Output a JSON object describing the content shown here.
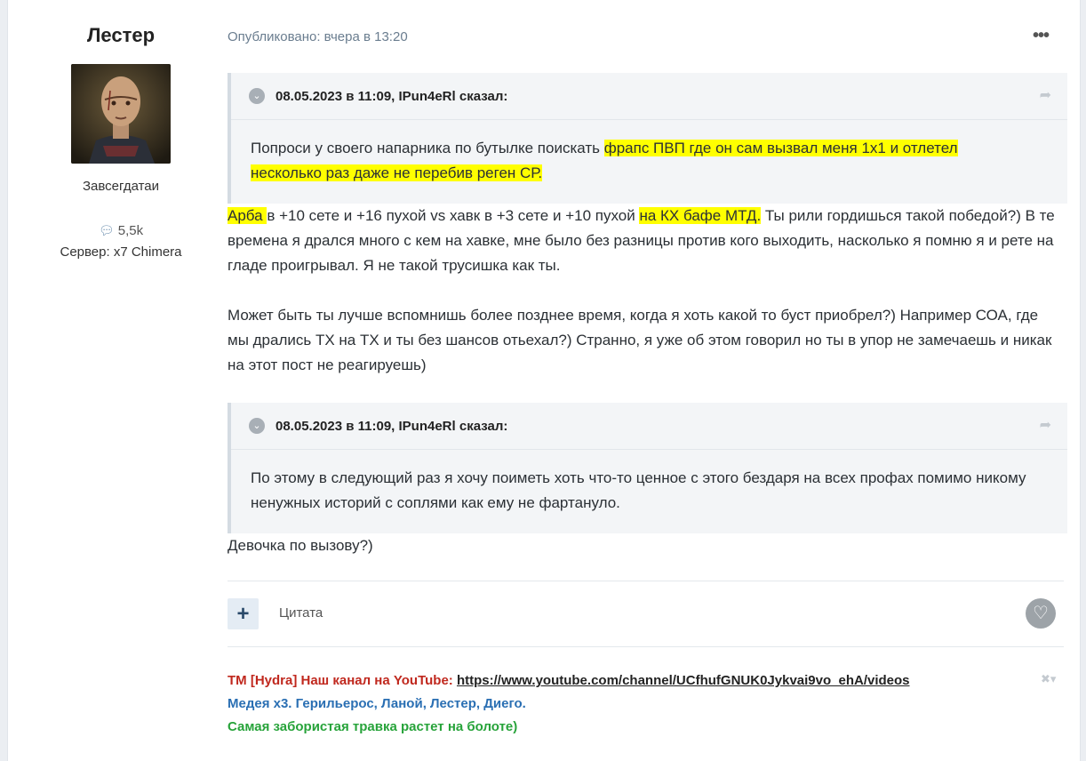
{
  "author": {
    "name": "Лестер",
    "rank": "Завсегдатаи",
    "reputation": "5,5k",
    "reputation_icon": "comment-icon",
    "server": "Сервер: x7 Chimera"
  },
  "post": {
    "published": "Опубликовано: вчера в 13:20",
    "more_icon": "•••",
    "quote1": {
      "cite": "08.05.2023 в 11:09, IPun4eRl сказал:",
      "text_plain": "Попроси у своего напарника по бутылке поискать ",
      "text_hl_1": "фрапс ПВП где он сам вызвал меня 1х1 и отлетел",
      "text_hl_2": "несколько раз даже не перебив реген СР."
    },
    "reply1": {
      "hl_a": "Арба ",
      "plain_a": " в +10 сете и +16 пухой vs хавк в +3 сете и +10 пухой ",
      "hl_b": "на КХ бафе МТД.",
      "plain_b": " Ты рили гордишься такой победой?) В те времена я дрался много с кем на хавке, мне было без разницы против кого выходить, насколько я помню я и рете на гладе проигрывал. Я не такой трусишка как ты."
    },
    "reply2": "Может быть ты лучше вспомнишь более позднее время, когда я хоть какой то буст приобрел?) Например СОА, где мы дрались ТХ на ТХ и ты без шансов отьехал?) Странно, я уже об этом говорил но ты в упор не замечаешь и никак на этот пост не реагируешь)",
    "quote2": {
      "cite": "08.05.2023 в 11:09, IPun4eRl сказал:",
      "text": "По этому в следующий раз я хочу поиметь хоть что-то ценное с этого бездаря на всех профах помимо никому ненужных историй с соплями как ему не фартануло."
    },
    "reply3": "Девочка по вызову?)",
    "actions": {
      "plus_label": "+",
      "quote_label": "Цитата"
    },
    "signature": {
      "line1_prefix": "ТМ [Hydra] Наш канал на YouTube: ",
      "line1_link": "https://www.youtube.com/channel/UCfhufGNUK0Jykvai9vo_ehA/videos",
      "line2": "Медея х3. Герильерос, Ланой, Лестер, Диего.",
      "line3": "Самая забористая травка растет на болоте)"
    }
  },
  "colors": {
    "highlight": "#ffff00",
    "sig_red": "#c0281e",
    "sig_blue": "#2a6fb3",
    "sig_green": "#27a33a"
  }
}
